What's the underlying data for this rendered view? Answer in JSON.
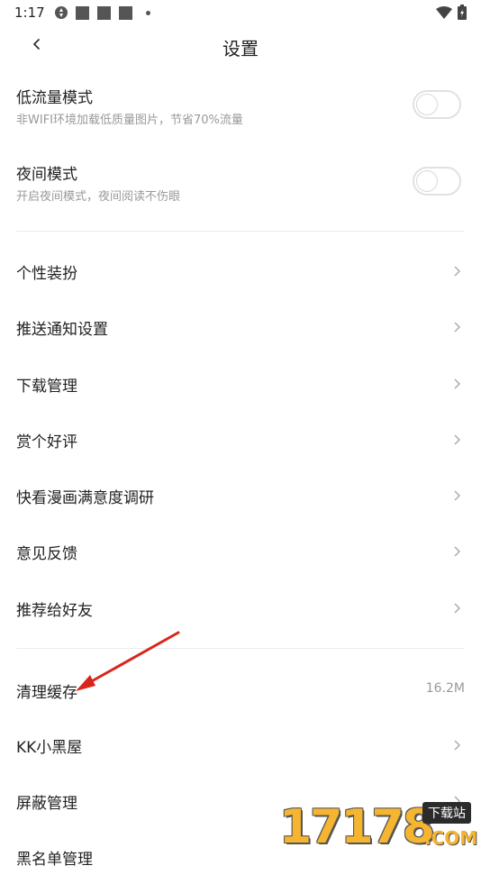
{
  "status_bar": {
    "time": "1:17"
  },
  "header": {
    "title": "设置"
  },
  "toggles": [
    {
      "title": "低流量模式",
      "subtitle": "非WIFI环境加载低质量图片，节省70%流量",
      "on": false
    },
    {
      "title": "夜间模式",
      "subtitle": "开启夜间模式，夜间阅读不伤眼",
      "on": false
    }
  ],
  "menu_group_1": [
    {
      "label": "个性装扮"
    },
    {
      "label": "推送通知设置"
    },
    {
      "label": "下载管理"
    },
    {
      "label": "赏个好评"
    },
    {
      "label": "快看漫画满意度调研"
    },
    {
      "label": "意见反馈"
    },
    {
      "label": "推荐给好友"
    }
  ],
  "menu_group_2": [
    {
      "label": "清理缓存",
      "value": "16.2M"
    },
    {
      "label": "KK小黑屋"
    },
    {
      "label": "屏蔽管理"
    },
    {
      "label": "黑名单管理"
    }
  ],
  "watermark": {
    "number": "17178",
    "tag": "下载站",
    "domain": ".COM"
  },
  "colors": {
    "annotation_arrow": "#d9261c",
    "watermark_gold": "#f5b531"
  }
}
